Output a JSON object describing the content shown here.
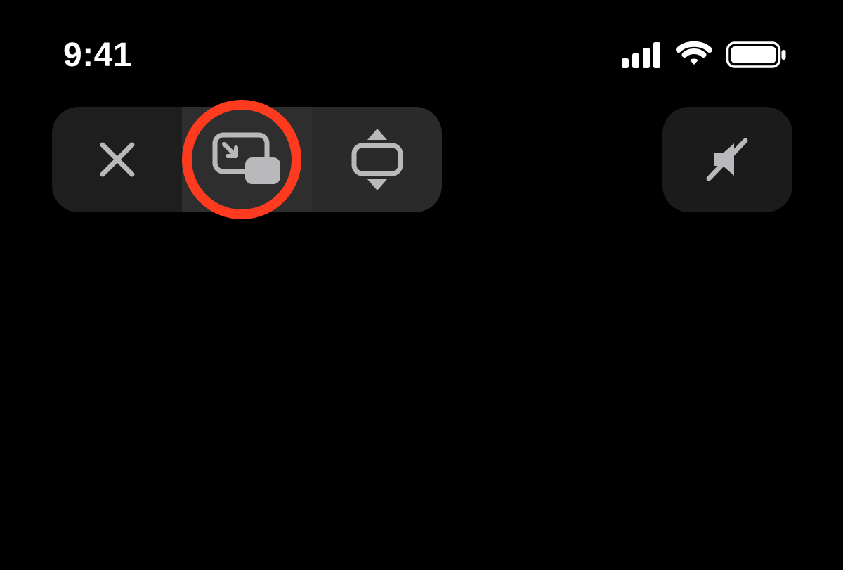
{
  "status_bar": {
    "time": "9:41",
    "icons": {
      "cellular": "cellular-signal-icon",
      "wifi": "wifi-icon",
      "battery": "battery-full-icon"
    }
  },
  "controls": {
    "left_group": [
      {
        "name": "close-button",
        "icon": "close-icon",
        "highlighted": false
      },
      {
        "name": "pip-button",
        "icon": "picture-in-picture-icon",
        "highlighted": true
      },
      {
        "name": "resize-button",
        "icon": "resize-vertical-icon",
        "highlighted": false
      }
    ],
    "right": {
      "name": "mute-button",
      "icon": "speaker-muted-icon"
    }
  },
  "highlight_color": "#ff3b1f"
}
